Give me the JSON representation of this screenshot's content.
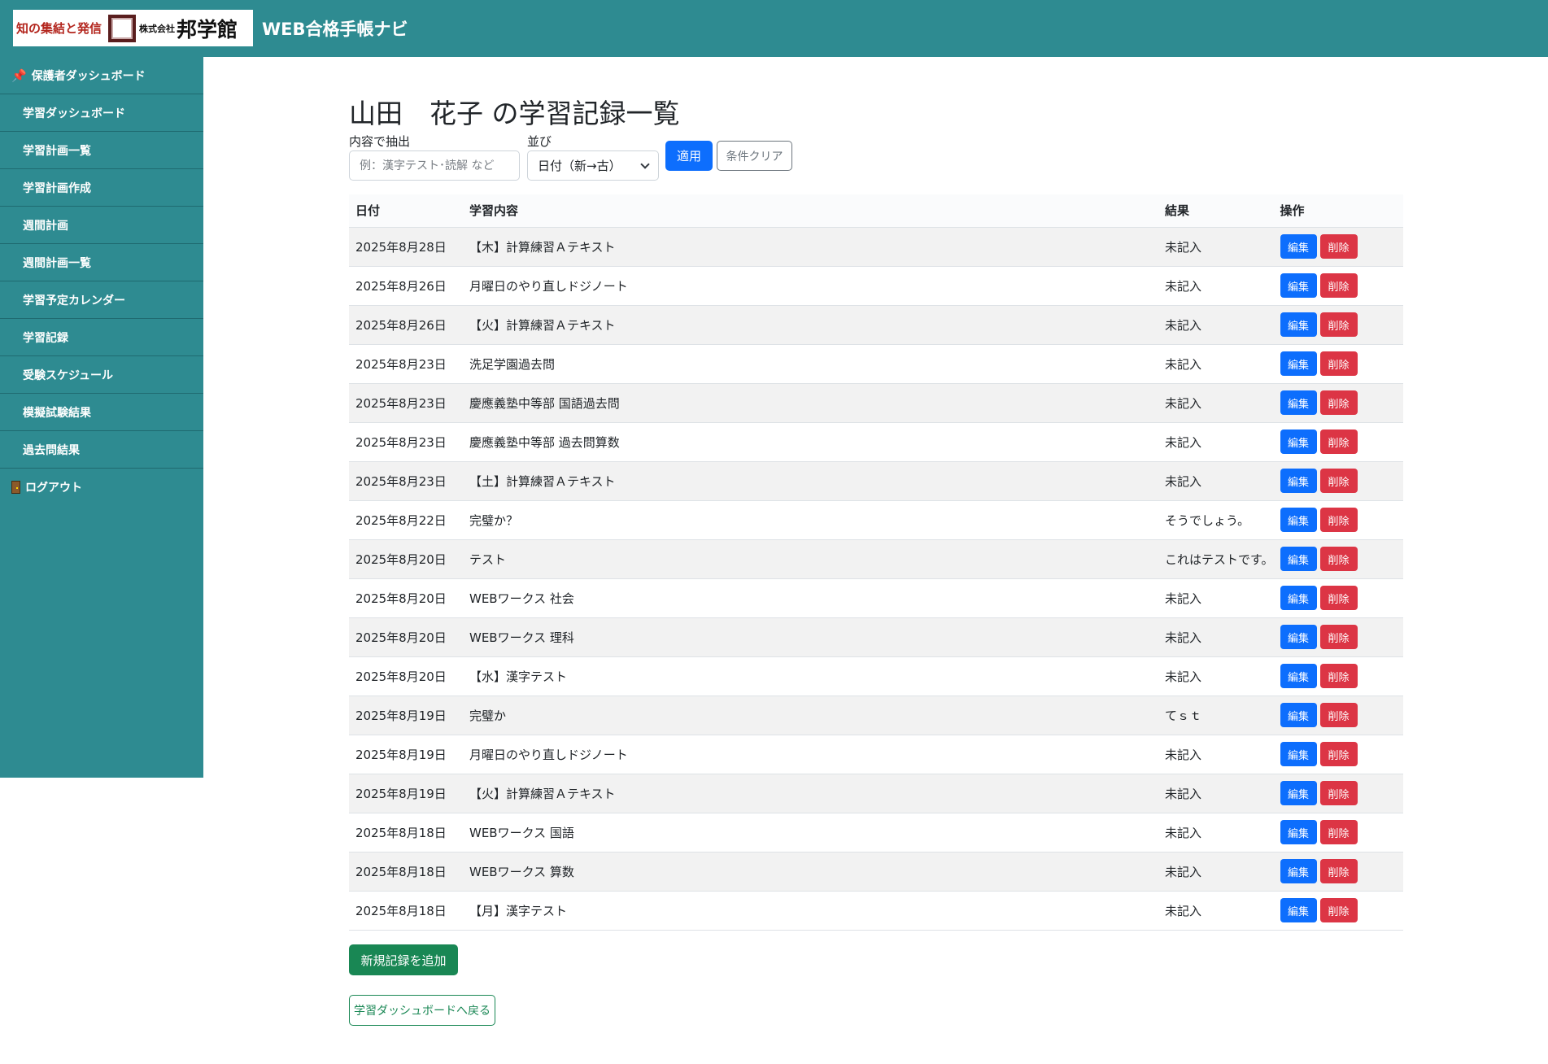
{
  "header": {
    "logo": {
      "tagline": "知の集結と発信",
      "company_prefix": "株式会社",
      "company_name": "邦学館"
    },
    "app_title": "WEB合格手帳ナビ"
  },
  "sidebar": {
    "items": [
      {
        "label": "保護者ダッシュボード",
        "icon": "pin-icon"
      },
      {
        "label": "学習ダッシュボード"
      },
      {
        "label": "学習計画一覧"
      },
      {
        "label": "学習計画作成"
      },
      {
        "label": "週間計画"
      },
      {
        "label": "週間計画一覧"
      },
      {
        "label": "学習予定カレンダー"
      },
      {
        "label": "学習記録"
      },
      {
        "label": "受験スケジュール"
      },
      {
        "label": "模擬試験結果"
      },
      {
        "label": "過去問結果"
      },
      {
        "label": "ログアウト",
        "icon": "door-icon"
      }
    ]
  },
  "main": {
    "title": "山田　花子 の学習記録一覧",
    "filter": {
      "content_label": "内容で抽出",
      "content_placeholder": "例：漢字テスト･読解 など",
      "sort_label": "並び",
      "sort_value": "日付（新→古）",
      "apply_label": "適用",
      "clear_label": "条件クリア"
    },
    "table": {
      "headers": {
        "date": "日付",
        "content": "学習内容",
        "result": "結果",
        "actions": "操作"
      },
      "edit_label": "編集",
      "delete_label": "削除",
      "rows": [
        {
          "date": "2025年8月28日",
          "content": "【木】計算練習Ａテキスト",
          "result": "未記入"
        },
        {
          "date": "2025年8月26日",
          "content": "月曜日のやり直しドジノート",
          "result": "未記入"
        },
        {
          "date": "2025年8月26日",
          "content": "【火】計算練習Ａテキスト",
          "result": "未記入"
        },
        {
          "date": "2025年8月23日",
          "content": "洗足学園過去問",
          "result": "未記入"
        },
        {
          "date": "2025年8月23日",
          "content": "慶應義塾中等部 国語過去問",
          "result": "未記入"
        },
        {
          "date": "2025年8月23日",
          "content": "慶應義塾中等部 過去問算数",
          "result": "未記入"
        },
        {
          "date": "2025年8月23日",
          "content": "【土】計算練習Ａテキスト",
          "result": "未記入"
        },
        {
          "date": "2025年8月22日",
          "content": "完璧か？",
          "result": "そうでしょう。"
        },
        {
          "date": "2025年8月20日",
          "content": "テスト",
          "result": "これはテストです。"
        },
        {
          "date": "2025年8月20日",
          "content": "WEBワークス 社会",
          "result": "未記入"
        },
        {
          "date": "2025年8月20日",
          "content": "WEBワークス 理科",
          "result": "未記入"
        },
        {
          "date": "2025年8月20日",
          "content": "【水】漢字テスト",
          "result": "未記入"
        },
        {
          "date": "2025年8月19日",
          "content": "完璧か",
          "result": "てｓｔ"
        },
        {
          "date": "2025年8月19日",
          "content": "月曜日のやり直しドジノート",
          "result": "未記入"
        },
        {
          "date": "2025年8月19日",
          "content": "【火】計算練習Ａテキスト",
          "result": "未記入"
        },
        {
          "date": "2025年8月18日",
          "content": "WEBワークス 国語",
          "result": "未記入"
        },
        {
          "date": "2025年8月18日",
          "content": "WEBワークス 算数",
          "result": "未記入"
        },
        {
          "date": "2025年8月18日",
          "content": "【月】漢字テスト",
          "result": "未記入"
        }
      ]
    },
    "add_label": "新規記録を追加",
    "back_label": "学習ダッシュボードへ戻る"
  },
  "colors": {
    "header_bg": "#2e8b91",
    "primary": "#0d6efd",
    "danger": "#dc3545",
    "success": "#198754"
  }
}
